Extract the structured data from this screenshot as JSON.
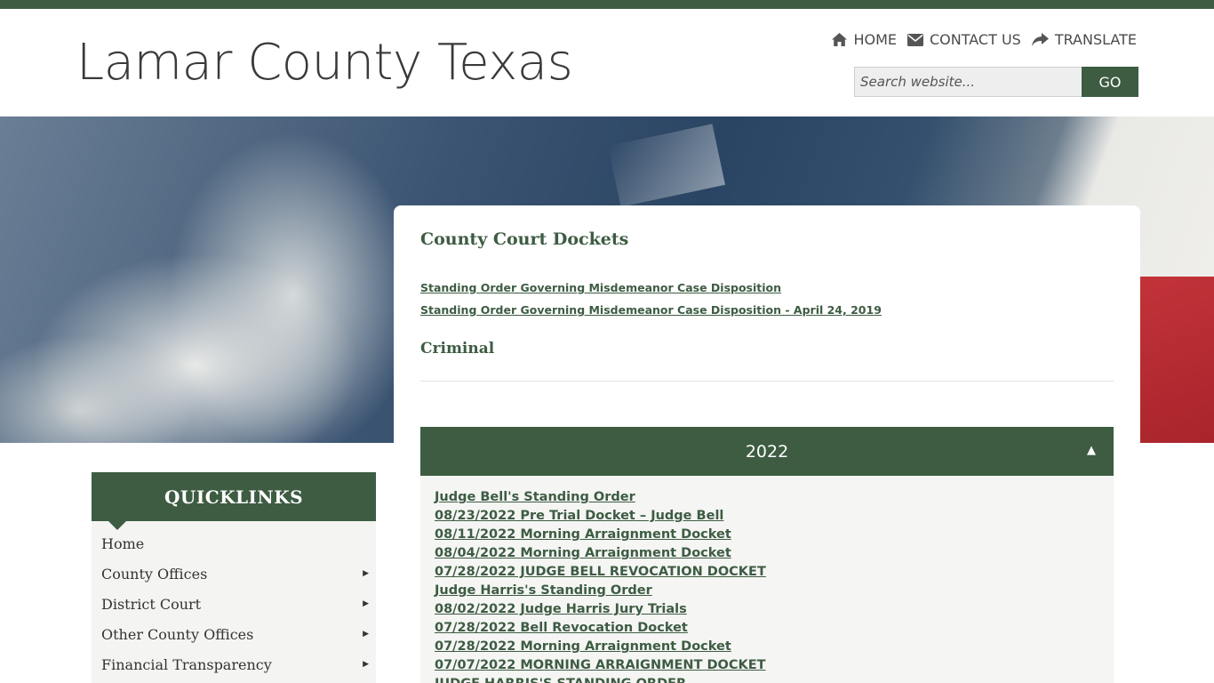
{
  "site": {
    "title": "Lamar County Texas"
  },
  "top_nav": {
    "items": [
      {
        "label": "HOME",
        "icon": "home-icon"
      },
      {
        "label": "CONTACT US",
        "icon": "envelope-icon"
      },
      {
        "label": "TRANSLATE",
        "icon": "share-arrow-icon"
      }
    ]
  },
  "search": {
    "placeholder": "Search website...",
    "button_label": "GO"
  },
  "main": {
    "title": "County Court Dockets",
    "order_links": [
      "Standing Order Governing Misdemeanor Case Disposition",
      "Standing Order Governing Misdemeanor Case Disposition - April 24, 2019"
    ],
    "section_heading": "Criminal",
    "accordion": {
      "year": "2022",
      "toggle_icon": "▲",
      "links": [
        "Judge Bell's Standing Order",
        "08/23/2022 Pre Trial  Docket – Judge Bell",
        "08/11/2022 Morning Arraignment Docket",
        "08/04/2022 Morning Arraignment Docket",
        "07/28/2022 JUDGE BELL REVOCATION DOCKET",
        "Judge Harris's Standing Order",
        "08/02/2022 Judge Harris Jury Trials",
        "07/28/2022 Bell Revocation Docket",
        "07/28/2022 Morning Arraignment Docket",
        "07/07/2022 MORNING ARRAIGNMENT DOCKET",
        "JUDGE HARRIS'S STANDING ORDER"
      ]
    }
  },
  "quicklinks": {
    "title": "QUICKLINKS",
    "items": [
      {
        "label": "Home",
        "has_submenu": false
      },
      {
        "label": "County Offices",
        "has_submenu": true
      },
      {
        "label": "District Court",
        "has_submenu": true
      },
      {
        "label": "Other County Offices",
        "has_submenu": true
      },
      {
        "label": "Financial Transparency",
        "has_submenu": true
      }
    ],
    "submenu_icon": "▶"
  },
  "colors": {
    "brand_green": "#3d5c42",
    "panel_gray": "#f4f4f2"
  }
}
